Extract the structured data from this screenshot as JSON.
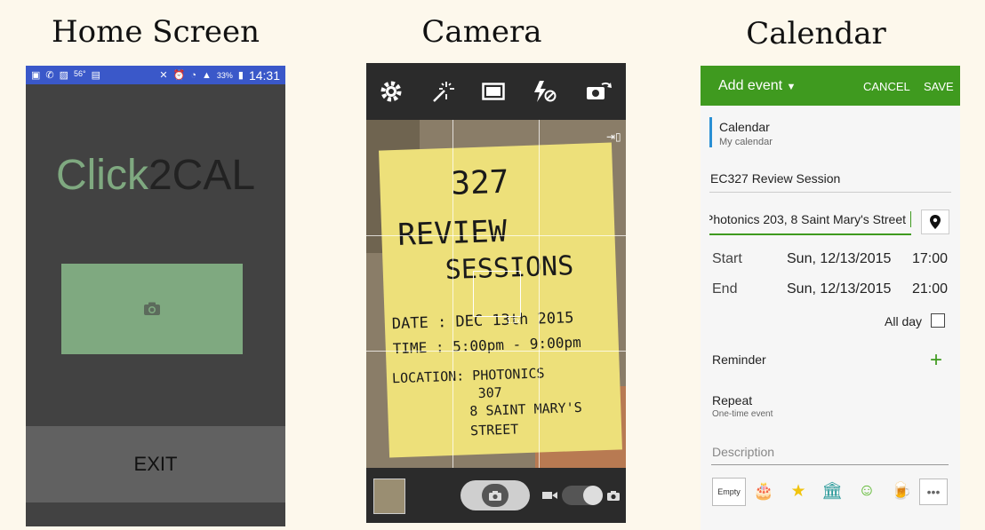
{
  "captions": {
    "home": "Home Screen",
    "camera": "Camera",
    "calendar": "Calendar"
  },
  "home": {
    "status_bar": {
      "temperature": "56°",
      "battery": "33%",
      "time": "14:31"
    },
    "logo_part1": "Click",
    "logo_part2": "2CAL",
    "camera_button_icon": "camera-icon",
    "exit_label": "EXIT",
    "colors": {
      "accent": "#7fa980",
      "background": "#424242",
      "exit_bg": "#616161",
      "status_bar": "#3a58c9"
    }
  },
  "camera": {
    "toolbar_icons": [
      "gear-icon",
      "effects-icon",
      "aspect-ratio-icon",
      "flash-off-icon",
      "switch-camera-icon"
    ],
    "note_text": {
      "line1": "327",
      "line2": "REVIEW",
      "line3": "SESSIONS",
      "date": "DATE : DEC 13th 2015",
      "time": "TIME : 5:00pm - 9:00pm",
      "location1": "LOCATION: PHOTONICS",
      "location2": "307",
      "location3": "8 SAINT MARY'S",
      "location4": "STREET"
    },
    "zoom": "1.1x"
  },
  "calendar": {
    "header": {
      "title": "Add event",
      "cancel": "CANCEL",
      "save": "SAVE",
      "color": "#3f9a1f"
    },
    "calendar_name": "Calendar",
    "calendar_account": "My calendar",
    "event_title": "EC327 Review Session",
    "location": "Photonics 203, 8 Saint Mary's Street",
    "start_label": "Start",
    "start_date": "Sun, 12/13/2015",
    "start_time": "17:00",
    "end_label": "End",
    "end_date": "Sun, 12/13/2015",
    "end_time": "21:00",
    "all_day_label": "All day",
    "all_day": false,
    "reminder_label": "Reminder",
    "repeat_label": "Repeat",
    "repeat_value": "One-time event",
    "description_placeholder": "Description",
    "stickers": [
      "Empty",
      "cake-icon",
      "star-icon",
      "bank-icon",
      "smiley-icon",
      "beer-icon",
      "more-icon"
    ]
  }
}
